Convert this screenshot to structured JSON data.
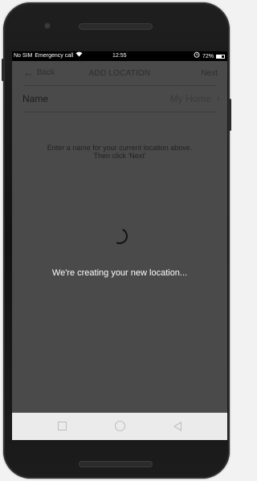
{
  "status": {
    "carrier": "No SIM",
    "emergency": "Emergency call",
    "time": "12:55",
    "battery": "72%",
    "icons": [
      "wifi-icon",
      "alarm-icon",
      "battery-icon"
    ]
  },
  "toolbar": {
    "back_label": "Back",
    "title": "ADD LOCATION",
    "next_label": "Next"
  },
  "form": {
    "name_label": "Name",
    "name_value": "My Home"
  },
  "hint_text": "Enter a name for your current location above. Then click 'Next'",
  "loading_text": "We're creating your new location...",
  "colors": {
    "screen_bg": "#4a4a4a",
    "navbar_bg": "#ebebeb",
    "status_bg": "#000000"
  }
}
